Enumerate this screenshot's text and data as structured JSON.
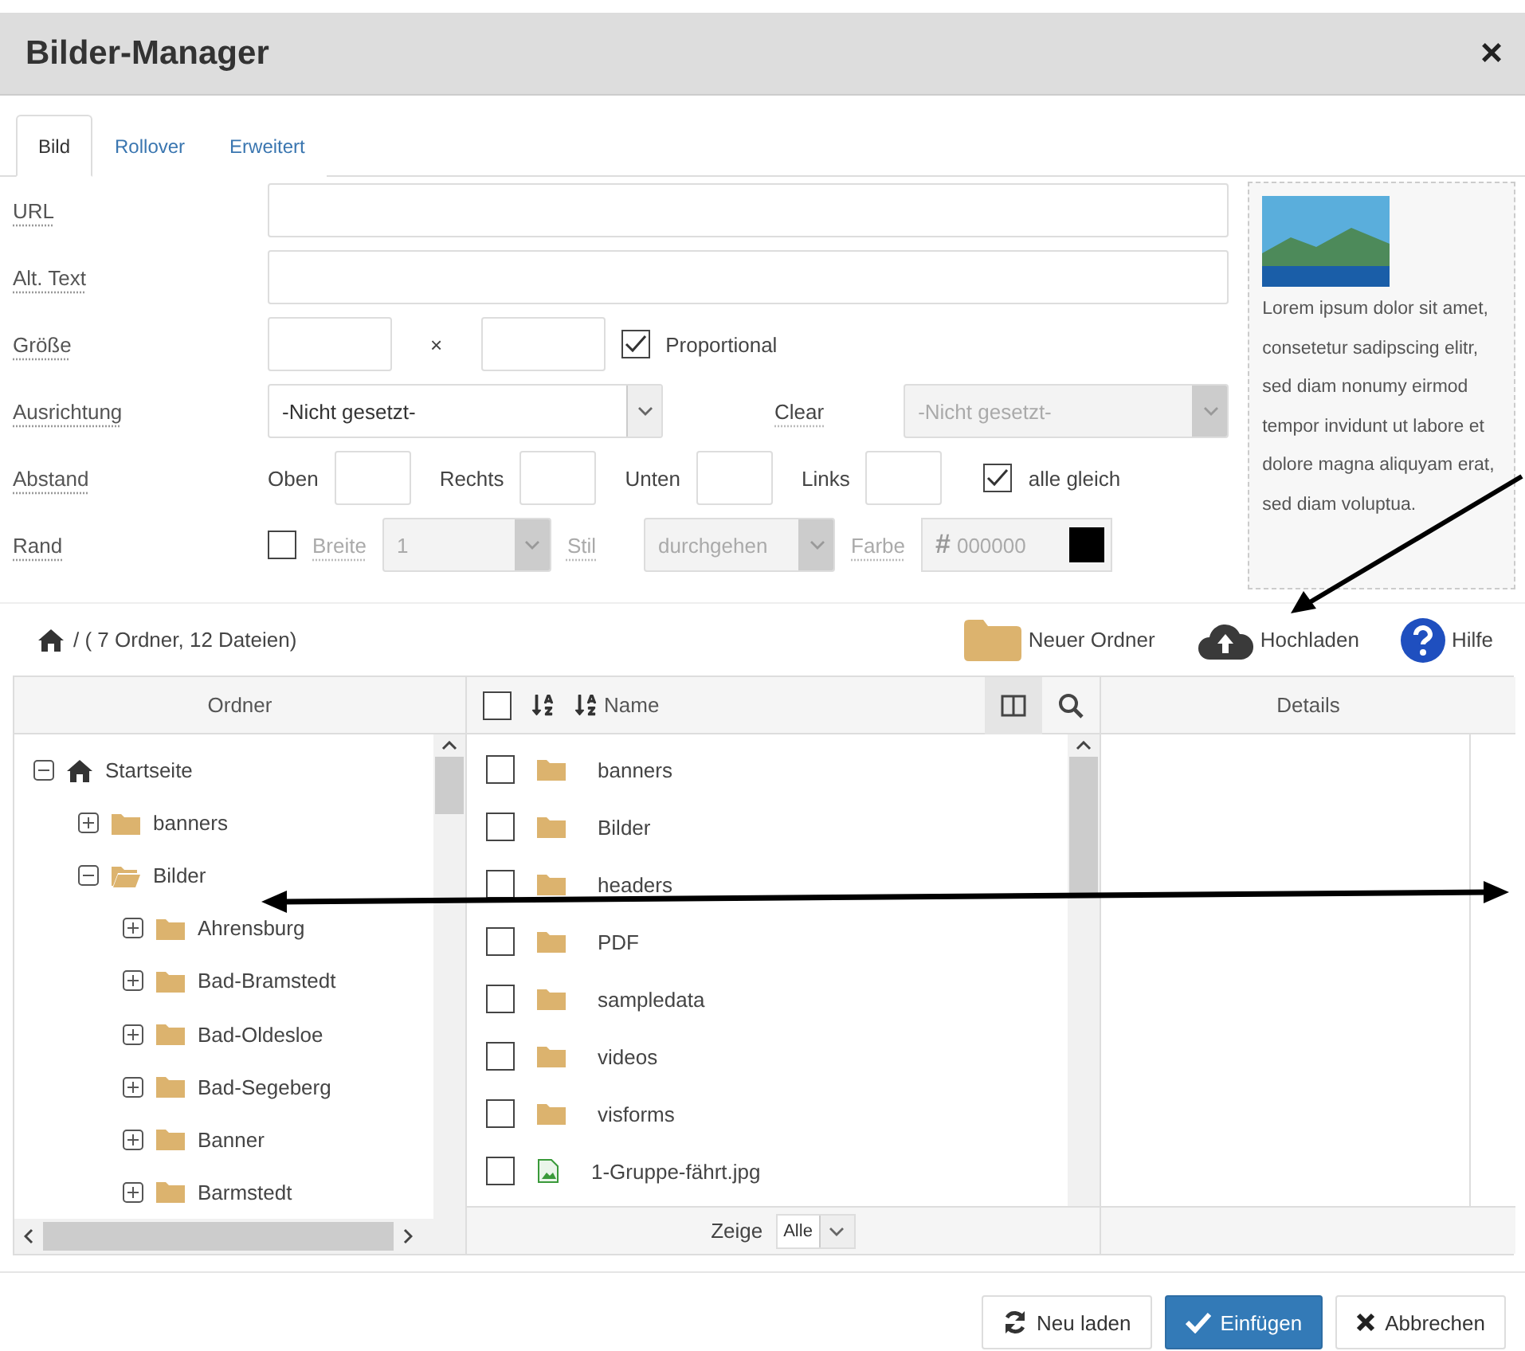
{
  "dialog": {
    "title": "Bilder-Manager",
    "close": "×"
  },
  "tabs": [
    {
      "label": "Bild",
      "selected": true
    },
    {
      "label": "Rollover",
      "selected": false
    },
    {
      "label": "Erweitert",
      "selected": false
    }
  ],
  "form": {
    "url": {
      "label": "URL"
    },
    "alt_text": {
      "label": "Alt. Text"
    },
    "size": {
      "label": "Größe",
      "separator": "×",
      "proportional": {
        "label": "Proportional",
        "checked": true
      }
    },
    "alignment": {
      "label": "Ausrichtung",
      "value": "-Nicht gesetzt-",
      "clear_label": "Clear",
      "clear_value": "-Nicht gesetzt-",
      "clear_disabled": true
    },
    "spacing": {
      "label": "Abstand",
      "fields": [
        "Oben",
        "Rechts",
        "Unten",
        "Links"
      ],
      "all_equal": {
        "label": "alle gleich",
        "checked": true
      }
    },
    "border": {
      "label": "Rand",
      "checked": false,
      "width_label": "Breite",
      "width_value": "1",
      "style_label": "Stil",
      "style_value": "durchgehen",
      "color_label": "Farbe",
      "color_prefix": "#",
      "color_value": "000000"
    }
  },
  "preview": {
    "text": "Lorem ipsum dolor sit amet, consetetur sadipscing elitr, sed diam nonumy eirmod tempor invidunt ut labore et dolore magna aliquyam erat, sed diam voluptua."
  },
  "toolbar": {
    "path": "/ ( 7 Ordner, 12 Dateien)",
    "actions": [
      {
        "label": "Neuer Ordner",
        "kind": "folder"
      },
      {
        "label": "Hochladen",
        "kind": "upload"
      },
      {
        "label": "Hilfe",
        "kind": "help"
      }
    ]
  },
  "folders": {
    "heading": "Ordner",
    "tree": [
      {
        "label": "Startseite",
        "kind": "home",
        "expanded": true,
        "children": [
          {
            "label": "banners",
            "expanded": false
          },
          {
            "label": "Bilder",
            "expanded": true,
            "children": [
              {
                "label": "Ahrensburg",
                "expanded": false
              },
              {
                "label": "Bad-Bramstedt",
                "expanded": false
              },
              {
                "label": "Bad-Oldesloe",
                "expanded": false
              },
              {
                "label": "Bad-Segeberg",
                "expanded": false
              },
              {
                "label": "Banner",
                "expanded": false
              },
              {
                "label": "Barmstedt",
                "expanded": false
              }
            ]
          }
        ]
      }
    ]
  },
  "files": {
    "heading": "Name",
    "all_checked": false,
    "rows": [
      {
        "name": "banners",
        "kind": "folder",
        "checked": false
      },
      {
        "name": "Bilder",
        "kind": "folder",
        "checked": false
      },
      {
        "name": "headers",
        "kind": "folder",
        "checked": false
      },
      {
        "name": "PDF",
        "kind": "folder",
        "checked": false
      },
      {
        "name": "sampledata",
        "kind": "folder",
        "checked": false
      },
      {
        "name": "videos",
        "kind": "folder",
        "checked": false
      },
      {
        "name": "visforms",
        "kind": "folder",
        "checked": false
      },
      {
        "name": "1-Gruppe-fährt.jpg",
        "kind": "image",
        "checked": false
      }
    ],
    "show_label": "Zeige",
    "show_value": "Alle"
  },
  "details": {
    "heading": "Details"
  },
  "buttons": [
    {
      "label": "Neu laden",
      "kind": "reload"
    },
    {
      "label": "Einfügen",
      "kind": "primary"
    },
    {
      "label": "Abbrechen",
      "kind": "cancel"
    }
  ]
}
